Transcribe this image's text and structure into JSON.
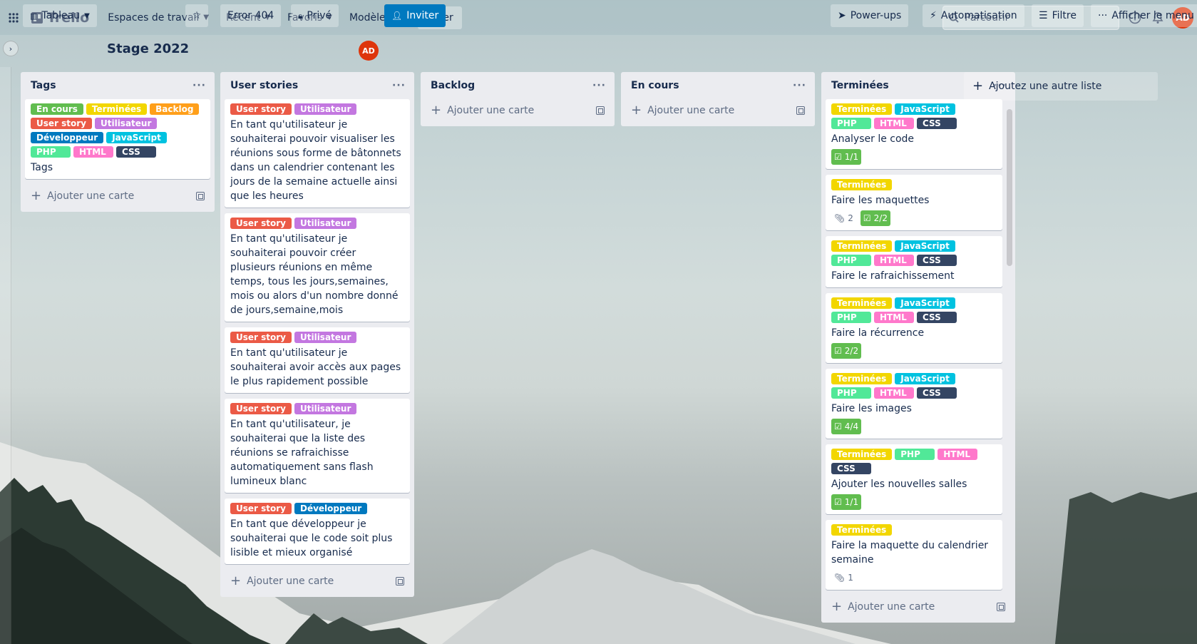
{
  "colors": {
    "green": "#61bd4f",
    "yellow": "#f2d600",
    "orange": "#ff9f1a",
    "red": "#eb5a46",
    "purple": "#c377e0",
    "blue": "#0079bf",
    "sky": "#00c2e0",
    "lime": "#51e898",
    "pink": "#ff78cb",
    "black": "#344563"
  },
  "nav": {
    "logo": "Trello",
    "workspaces": "Espaces de travail",
    "recent": "Récent",
    "favorites": "Favoris",
    "templates": "Modèles",
    "create": "Créer",
    "search_placeholder": "Parcourir",
    "avatar": "AD",
    "icons": [
      "apps-grid-icon",
      "info-icon",
      "bell-icon"
    ]
  },
  "board": {
    "view": "Tableau",
    "title": "Stage 2022",
    "workspace": "Error 404",
    "visibility": "Privé",
    "member": "AD",
    "invite": "Inviter",
    "powerups": "Power-ups",
    "automation": "Automatisation",
    "filter": "Filtre",
    "menu": "Afficher le menu"
  },
  "add_card": "Ajouter une carte",
  "add_list": "Ajoutez une autre liste",
  "lists": [
    {
      "name": "Tags",
      "cards": [
        {
          "labels": [
            {
              "text": "En cours",
              "color": "green"
            },
            {
              "text": "Terminées",
              "color": "yellow"
            },
            {
              "text": "Backlog",
              "color": "orange"
            },
            {
              "text": "User story",
              "color": "red"
            },
            {
              "text": "Utilisateur",
              "color": "purple"
            },
            {
              "text": "Développeur",
              "color": "blue"
            },
            {
              "text": "JavaScript",
              "color": "sky"
            },
            {
              "text": "PHP",
              "color": "lime"
            },
            {
              "text": "HTML",
              "color": "pink"
            },
            {
              "text": "CSS",
              "color": "black"
            }
          ],
          "title": "Tags"
        }
      ]
    },
    {
      "name": "User stories",
      "cards": [
        {
          "labels": [
            {
              "text": "User story",
              "color": "red"
            },
            {
              "text": "Utilisateur",
              "color": "purple"
            }
          ],
          "title": "En tant qu'utilisateur je souhaiterai pouvoir visualiser les réunions sous forme de bâtonnets dans un calendrier contenant les jours de la semaine actuelle ainsi que les heures"
        },
        {
          "labels": [
            {
              "text": "User story",
              "color": "red"
            },
            {
              "text": "Utilisateur",
              "color": "purple"
            }
          ],
          "title": "En tant qu'utilisateur je souhaiterai pouvoir créer plusieurs réunions en même temps, tous les jours,semaines, mois ou alors d'un nombre donné de jours,semaine,mois"
        },
        {
          "labels": [
            {
              "text": "User story",
              "color": "red"
            },
            {
              "text": "Utilisateur",
              "color": "purple"
            }
          ],
          "title": "En tant qu'utilisateur je souhaiterai avoir accès aux pages le plus rapidement possible"
        },
        {
          "labels": [
            {
              "text": "User story",
              "color": "red"
            },
            {
              "text": "Utilisateur",
              "color": "purple"
            }
          ],
          "title": "En tant qu'utilisateur, je souhaiterai que la liste des réunions se rafraichisse automatiquement sans flash lumineux blanc"
        },
        {
          "labels": [
            {
              "text": "User story",
              "color": "red"
            },
            {
              "text": "Développeur",
              "color": "blue"
            }
          ],
          "title": "En tant que développeur je souhaiterai que le code soit plus lisible et mieux organisé"
        }
      ]
    },
    {
      "name": "Backlog",
      "cards": []
    },
    {
      "name": "En cours",
      "cards": []
    },
    {
      "name": "Terminées",
      "cards": [
        {
          "labels": [
            {
              "text": "Terminées",
              "color": "yellow"
            },
            {
              "text": "JavaScript",
              "color": "sky"
            },
            {
              "text": "PHP",
              "color": "lime"
            },
            {
              "text": "HTML",
              "color": "pink"
            },
            {
              "text": "CSS",
              "color": "black"
            }
          ],
          "title": "Analyser le code",
          "checklist": "1/1"
        },
        {
          "labels": [
            {
              "text": "Terminées",
              "color": "yellow"
            }
          ],
          "title": "Faire les maquettes",
          "attachments": "2",
          "checklist": "2/2"
        },
        {
          "labels": [
            {
              "text": "Terminées",
              "color": "yellow"
            },
            {
              "text": "JavaScript",
              "color": "sky"
            },
            {
              "text": "PHP",
              "color": "lime"
            },
            {
              "text": "HTML",
              "color": "pink"
            },
            {
              "text": "CSS",
              "color": "black"
            }
          ],
          "title": "Faire le rafraichissement"
        },
        {
          "labels": [
            {
              "text": "Terminées",
              "color": "yellow"
            },
            {
              "text": "JavaScript",
              "color": "sky"
            },
            {
              "text": "PHP",
              "color": "lime"
            },
            {
              "text": "HTML",
              "color": "pink"
            },
            {
              "text": "CSS",
              "color": "black"
            }
          ],
          "title": "Faire la récurrence",
          "checklist": "2/2"
        },
        {
          "labels": [
            {
              "text": "Terminées",
              "color": "yellow"
            },
            {
              "text": "JavaScript",
              "color": "sky"
            },
            {
              "text": "PHP",
              "color": "lime"
            },
            {
              "text": "HTML",
              "color": "pink"
            },
            {
              "text": "CSS",
              "color": "black"
            }
          ],
          "title": "Faire les images",
          "checklist": "4/4"
        },
        {
          "labels": [
            {
              "text": "Terminées",
              "color": "yellow"
            },
            {
              "text": "PHP",
              "color": "lime"
            },
            {
              "text": "HTML",
              "color": "pink"
            },
            {
              "text": "CSS",
              "color": "black"
            }
          ],
          "title": "Ajouter les nouvelles salles",
          "checklist": "1/1"
        },
        {
          "labels": [
            {
              "text": "Terminées",
              "color": "yellow"
            }
          ],
          "title": "Faire la maquette du calendrier semaine",
          "attachments": "1"
        }
      ]
    }
  ]
}
